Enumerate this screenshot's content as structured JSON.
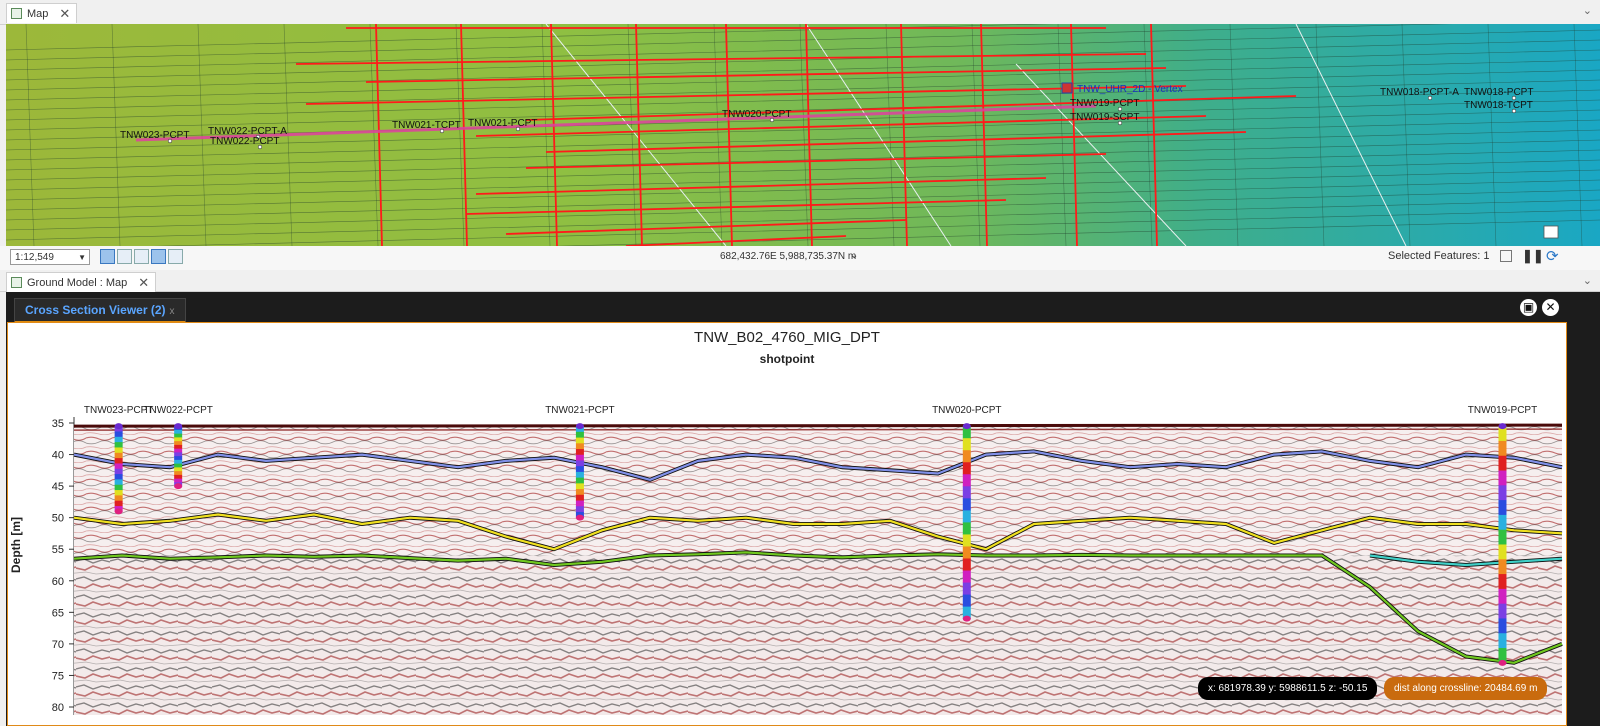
{
  "map_tab": {
    "label": "Map",
    "close": "✕",
    "icon": "map-icon"
  },
  "map": {
    "cpt_labels": [
      {
        "text": "TNW023-PCPT"
      },
      {
        "text": "TNW022-PCPT-A"
      },
      {
        "text": "TNW022-PCPT"
      },
      {
        "text": "TNW021-TCPT"
      },
      {
        "text": "TNW021-PCPT"
      },
      {
        "text": "TNW020-PCPT"
      },
      {
        "text": "TNW019-PCPT"
      },
      {
        "text": "TNW019-SCPT"
      },
      {
        "text": "TNW018-PCPT-A"
      },
      {
        "text": "TNW018-PCPT"
      },
      {
        "text": "TNW018-TCPT"
      }
    ],
    "vertex_label": "TNW_UHR_2D - Vertex",
    "colors": {
      "grid_red": "#ff1a1a",
      "profile_line": "#e040a0"
    }
  },
  "status": {
    "scale": "1:12,549",
    "coordinates": "682,432.76E 5,988,735.37N m",
    "selected_features": "Selected Features: 1"
  },
  "ground_tab": {
    "label": "Ground Model : Map",
    "close": "✕"
  },
  "viewer_tab": {
    "label": "Cross Section Viewer (2)",
    "close": "x"
  },
  "viewer": {
    "title": "TNW_B02_4760_MIG_DPT",
    "subtitle": "shotpoint",
    "xyz_readout": "x: 681978.39 y: 5988611.5 z: -50.15",
    "dist_readout": "dist along crossline: 20484.69 m"
  },
  "chart_data": {
    "type": "line",
    "ylabel": "Depth [m]",
    "y_ticks": [
      "35",
      "40",
      "45",
      "50",
      "55",
      "60",
      "65",
      "70",
      "75",
      "80"
    ],
    "ylim": [
      35,
      80
    ],
    "y_reversed": true,
    "boreholes": [
      {
        "name": "TNW023-PCPT",
        "position": 0.03,
        "top": 35.5,
        "bottom": 49
      },
      {
        "name": "TNW022-PCPT",
        "position": 0.07,
        "top": 35.5,
        "bottom": 45
      },
      {
        "name": "TNW021-PCPT",
        "position": 0.34,
        "top": 35.5,
        "bottom": 50
      },
      {
        "name": "TNW020-PCPT",
        "position": 0.6,
        "top": 35.5,
        "bottom": 66
      },
      {
        "name": "TNW019-PCPT",
        "position": 0.96,
        "top": 35.5,
        "bottom": 73
      }
    ],
    "horizons": [
      {
        "color": "#8090e8",
        "depths": [
          40,
          41.5,
          42,
          40,
          41,
          40.5,
          40,
          41,
          42,
          41,
          40.5,
          42,
          44,
          41,
          40,
          40.5,
          42,
          42.5,
          43,
          40,
          39.5,
          41,
          42,
          41.5,
          42,
          40,
          39.5,
          41,
          42,
          40,
          40.5,
          42
        ]
      },
      {
        "color": "#f0e020",
        "depths": [
          50,
          51,
          50.5,
          49.5,
          50.5,
          49.5,
          51,
          50,
          50.5,
          53,
          55,
          52,
          50,
          50.5,
          50,
          51,
          51,
          50.5,
          53,
          55,
          51,
          50.5,
          50,
          50.5,
          51,
          54,
          52,
          50,
          51,
          51,
          52,
          52.5
        ]
      },
      {
        "color": "#70c820",
        "depths": [
          56.5,
          56,
          56.5,
          56.3,
          56,
          56.2,
          56,
          56.4,
          56.8,
          56.5,
          57.5,
          57,
          56,
          55.8,
          55.5,
          56,
          56.3,
          56,
          55.8,
          56,
          56,
          55.9,
          56,
          56,
          56,
          56,
          56,
          61,
          68,
          72,
          73,
          70
        ]
      },
      {
        "color": "#40d0c8",
        "depths": [
          null,
          null,
          null,
          null,
          null,
          null,
          null,
          null,
          null,
          null,
          null,
          null,
          null,
          null,
          null,
          null,
          null,
          null,
          null,
          null,
          null,
          null,
          null,
          null,
          null,
          null,
          null,
          56,
          57,
          57.5,
          57,
          56.5
        ]
      }
    ]
  }
}
